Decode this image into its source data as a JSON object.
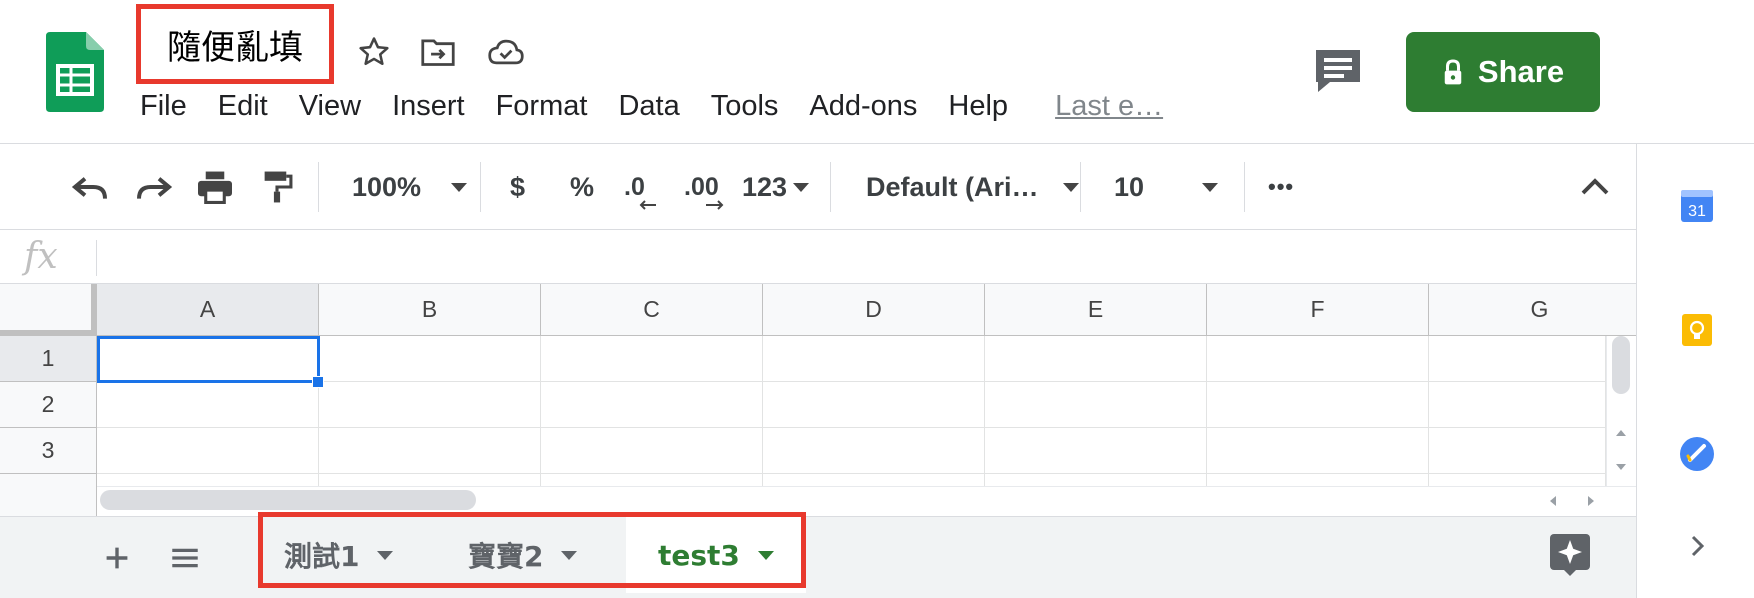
{
  "document": {
    "title": "隨便亂填",
    "last_edit": "Last e…"
  },
  "menu": [
    "File",
    "Edit",
    "View",
    "Insert",
    "Format",
    "Data",
    "Tools",
    "Add-ons",
    "Help"
  ],
  "header": {
    "share_label": "Share"
  },
  "toolbar": {
    "zoom": "100%",
    "currency": "$",
    "percent": "%",
    "decrease_decimal": ".0",
    "increase_decimal": ".00",
    "more_formats": "123",
    "font": "Default (Ari…",
    "font_size": "10",
    "more": "•••"
  },
  "formula_bar": {
    "label": "fx",
    "value": ""
  },
  "grid": {
    "columns": [
      "A",
      "B",
      "C",
      "D",
      "E",
      "F",
      "G"
    ],
    "rows": [
      "1",
      "2",
      "3"
    ],
    "selected_cell": "A1"
  },
  "sheets": {
    "tabs": [
      {
        "label": "測試1",
        "active": false
      },
      {
        "label": "寶寶2",
        "active": false
      },
      {
        "label": "test3",
        "active": true
      }
    ]
  },
  "side_panel": {
    "calendar_day": "31"
  },
  "colors": {
    "accent_green": "#2e7d32",
    "highlight_red": "#e8392d",
    "selection_blue": "#1a73e8"
  }
}
